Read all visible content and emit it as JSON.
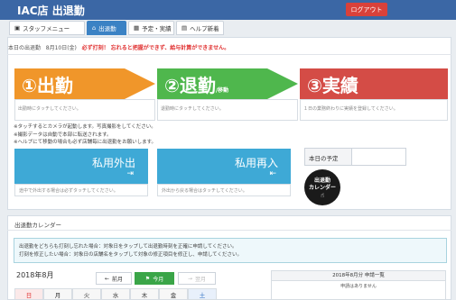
{
  "header": {
    "title": "IAC店 出退勤",
    "logout_label": "ログアウト"
  },
  "tabs": [
    {
      "label": "スタッフメニュー",
      "icon": "home-icon"
    },
    {
      "label": "出退勤",
      "icon": "house-icon",
      "active": true
    },
    {
      "label": "予定・実績",
      "icon": "calendar-icon"
    },
    {
      "label": "ヘルプ新着",
      "icon": "briefcase-icon"
    }
  ],
  "date_row": {
    "label": "本日の出退勤",
    "date": "8月10日(金)",
    "warning": "必ず打刻！ 忘れると把握ができず、給与計算ができません。"
  },
  "big_buttons": [
    {
      "label": "①出勤",
      "sub": "",
      "color": "#f0962a",
      "note": "出勤時にタッチしてください。"
    },
    {
      "label": "②退勤",
      "sub": "/移動",
      "color": "#4fb74d",
      "note": "退勤時にタッチしてください。"
    },
    {
      "label": "③実績",
      "sub": "",
      "color": "#d44c46",
      "note": "１日の業務終わりに実績を登録してください。"
    }
  ],
  "notes": [
    "※タッチするとカメラが起動します。写真撮影をしてください。",
    "※撮影データは自動で本部に転送されます。",
    "※ヘルプにて移動の場合も必ず店舗毎に出退勤をお願いします。"
  ],
  "private_buttons": [
    {
      "label": "私用外出",
      "icon": "exit-icon",
      "note": "途中で外出する場合は必ずタッチしてください。"
    },
    {
      "label": "私用再入",
      "icon": "enter-icon",
      "note": "外出から戻る場合はタッチしてください。"
    }
  ],
  "plan": {
    "label": "本日の予定",
    "value": ""
  },
  "calendar_button": {
    "line1": "出退勤",
    "line2": "カレンダー"
  },
  "section": {
    "title": "出退勤カレンダー",
    "info": [
      "出退勤をどちらも打刻し忘れた場合：対象日をタップして出退勤時刻を正確に申請してください。",
      "打刻を修正したい場合：対象日の店舗名をタップして対象の修正項目を修正し、申請してください。"
    ]
  },
  "calendar": {
    "month": "2018年8月",
    "prev_label": "前月",
    "today_label": "今月",
    "next_label": "翌月",
    "weekdays": [
      "日",
      "月",
      "火",
      "水",
      "木",
      "金",
      "土"
    ]
  },
  "applications": {
    "title": "2018年8月分 申請一覧",
    "empty": "申請はありません"
  }
}
